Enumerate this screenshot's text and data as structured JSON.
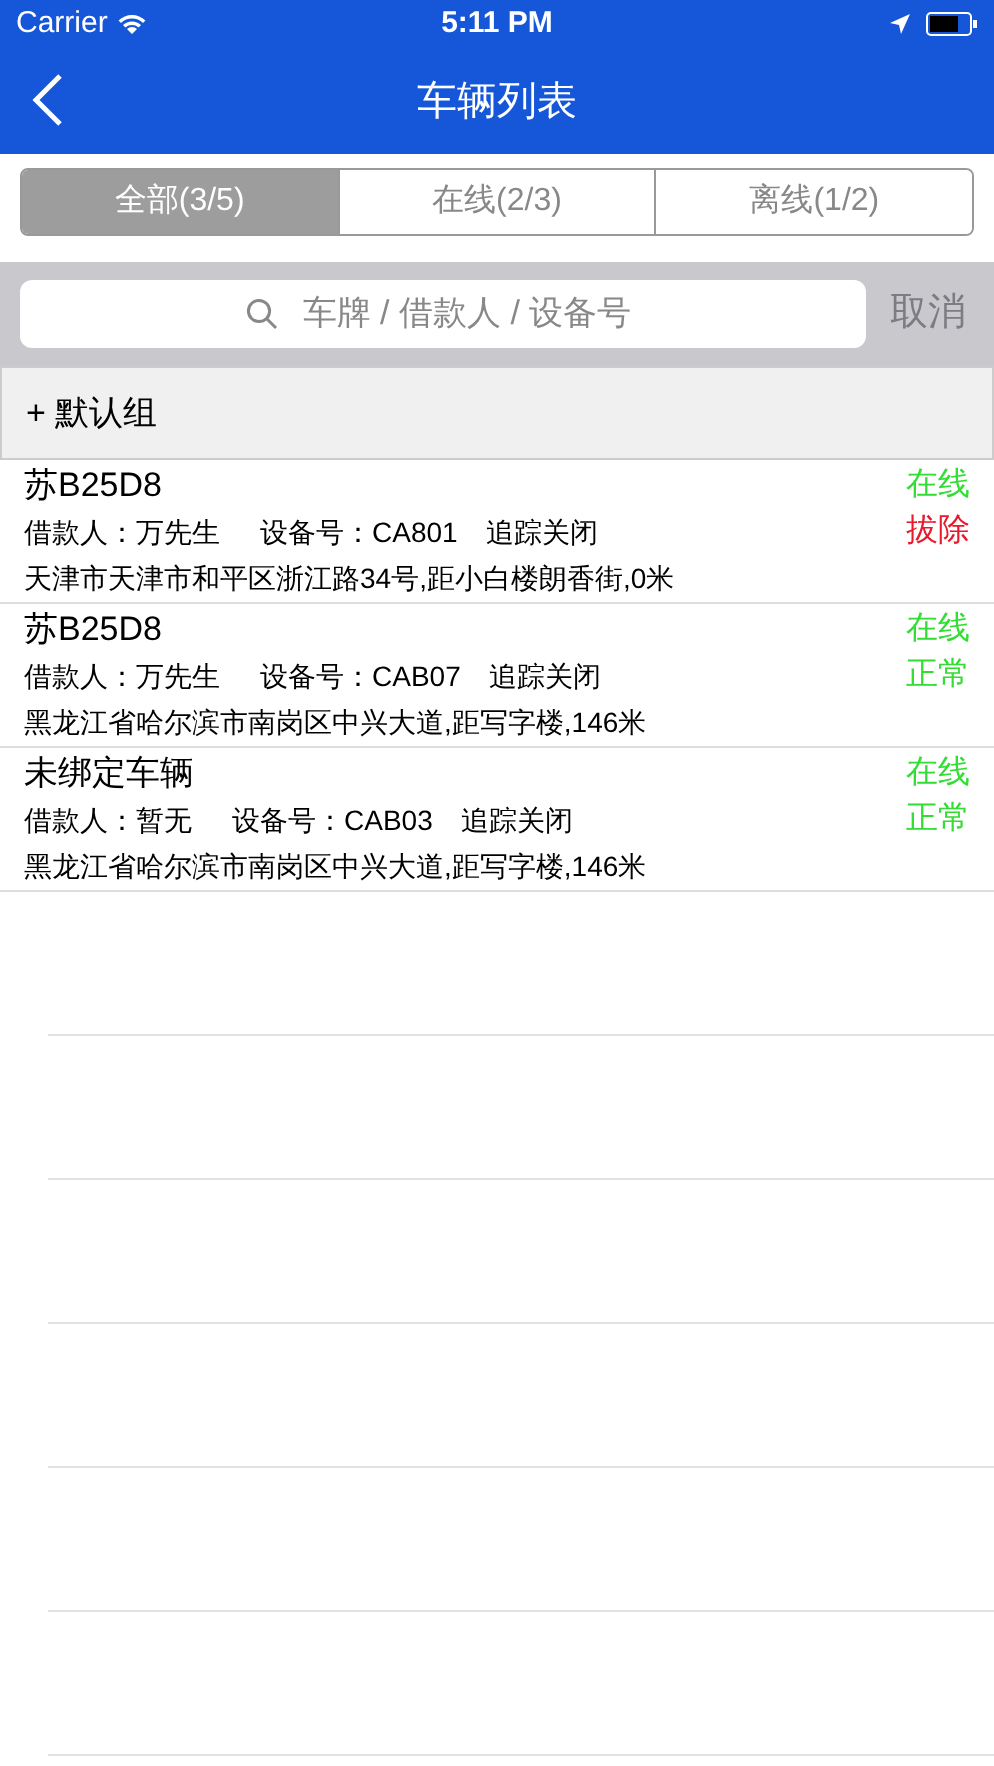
{
  "status_bar": {
    "carrier": "Carrier",
    "time": "5:11 PM"
  },
  "nav": {
    "title": "车辆列表"
  },
  "tabs": [
    {
      "label": "全部(3/5)",
      "selected": true
    },
    {
      "label": "在线(2/3)",
      "selected": false
    },
    {
      "label": "离线(1/2)",
      "selected": false
    }
  ],
  "search": {
    "placeholder": "车牌 / 借款人 / 设备号",
    "cancel": "取消"
  },
  "group": {
    "label": "+ 默认组"
  },
  "vehicles": [
    {
      "name": "苏B25D8",
      "borrower": "借款人：万先生",
      "device": "设备号：CA801",
      "tracking": "追踪关闭",
      "address": "天津市天津市和平区浙江路34号,距小白楼朗香街,0米",
      "online": {
        "text": "在线",
        "color": "#33dd33"
      },
      "state": {
        "text": "拔除",
        "color": "#e8192c"
      }
    },
    {
      "name": "苏B25D8",
      "borrower": "借款人：万先生",
      "device": "设备号：CAB07",
      "tracking": "追踪关闭",
      "address": "黑龙江省哈尔滨市南岗区中兴大道,距写字楼,146米",
      "online": {
        "text": "在线",
        "color": "#33dd33"
      },
      "state": {
        "text": "正常",
        "color": "#33dd33"
      }
    },
    {
      "name": "未绑定车辆",
      "borrower": "借款人：暂无",
      "device": "设备号：CAB03",
      "tracking": "追踪关闭",
      "address": "黑龙江省哈尔滨市南岗区中兴大道,距写字楼,146米",
      "online": {
        "text": "在线",
        "color": "#33dd33"
      },
      "state": {
        "text": "正常",
        "color": "#33dd33"
      }
    }
  ]
}
